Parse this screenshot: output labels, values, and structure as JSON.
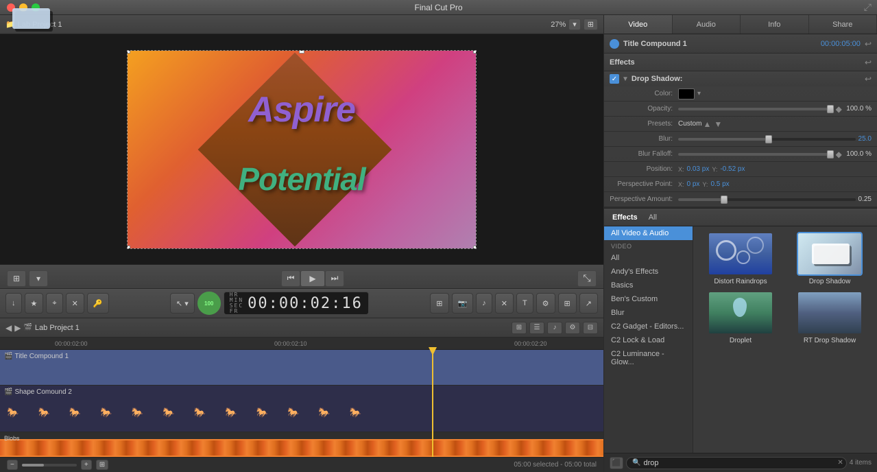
{
  "app": {
    "title": "Final Cut Pro"
  },
  "titlebar": {
    "title": "Final Cut Pro"
  },
  "preview": {
    "project_label": "Lab Project 1",
    "zoom": "27%",
    "text_aspire": "Aspire",
    "text_potential": "Potential"
  },
  "transport": {
    "go_start": "⏮",
    "play": "▶",
    "go_end": "⏭",
    "expand": "⤡"
  },
  "toolbar": {
    "add_btn": "↓",
    "fav_btn": "★",
    "rate_btn": "⌖",
    "reject_btn": "✕",
    "keywords_btn": "🔑",
    "select_tool": "↖",
    "select_arrow": "▾",
    "timecode": "00:00:02:16",
    "tc_hr": "HR",
    "tc_min": "MIN",
    "tc_sec": "SEC",
    "tc_fr": "FR",
    "percentage": "100",
    "clip_btn1": "▣",
    "clip_btn2": "📷",
    "clip_btn3": "♪",
    "clip_btn4": "✕",
    "clip_btn5": "T",
    "clip_btn6": "⚙",
    "clip_btn7": "⊞",
    "share_btn": "↗"
  },
  "timeline": {
    "project": "Lab Project 1",
    "tc1": "00:00:02:00",
    "tc2": "00:00:02:10",
    "tc3": "00:00:02:20",
    "tracks": [
      {
        "name": "Title Compound 1",
        "type": "compound"
      },
      {
        "name": "Shape Comound 2",
        "type": "shape"
      },
      {
        "name": "Blobs",
        "type": "blobs"
      }
    ]
  },
  "inspector": {
    "title": "Title Compound 1",
    "time": "00:00:05:00",
    "tabs": [
      "Video",
      "Audio",
      "Info",
      "Share"
    ],
    "effects_label": "Effects",
    "drop_shadow": {
      "name": "Drop Shadow:",
      "color_label": "Color:",
      "opacity_label": "Opacity:",
      "opacity_value": "100.0 %",
      "presets_label": "Presets:",
      "presets_value": "Custom",
      "blur_label": "Blur:",
      "blur_value": "25.0",
      "blur_falloff_label": "Blur Falloff:",
      "blur_falloff_value": "100.0 %",
      "position_label": "Position:",
      "position_x_label": "X:",
      "position_x_value": "0.03 px",
      "position_y_label": "Y:",
      "position_y_value": "-0.52 px",
      "perspective_point_label": "Perspective Point:",
      "pp_x_label": "X:",
      "pp_x_value": "0 px",
      "pp_y_label": "Y:",
      "pp_y_value": "0.5 px",
      "perspective_amount_label": "Perspective Amount:",
      "perspective_amount_value": "0.25"
    }
  },
  "effects_browser": {
    "tabs": [
      "Effects",
      "All"
    ],
    "categories_header": "VIDEO",
    "categories": [
      {
        "name": "All Video & Audio",
        "active": true
      },
      {
        "name": "VIDEO",
        "is_header": true
      },
      {
        "name": "All"
      },
      {
        "name": "Andy's Effects"
      },
      {
        "name": "Basics"
      },
      {
        "name": "Ben's Custom"
      },
      {
        "name": "Blur"
      },
      {
        "name": "C2 Gadget - Editors..."
      },
      {
        "name": "C2 Lock & Load"
      },
      {
        "name": "C2 Luminance - Glow..."
      }
    ],
    "effects": [
      {
        "name": "Distort Raindrops",
        "type": "distort"
      },
      {
        "name": "Drop Shadow",
        "type": "dropshadow",
        "selected": true
      },
      {
        "name": "Droplet",
        "type": "droplet"
      },
      {
        "name": "RT Drop Shadow",
        "type": "rt_drop"
      }
    ],
    "search_value": "drop",
    "items_count": "4 items",
    "search_placeholder": "Search"
  },
  "status_bar": {
    "selected": "05:00 selected - 05:00 total"
  }
}
